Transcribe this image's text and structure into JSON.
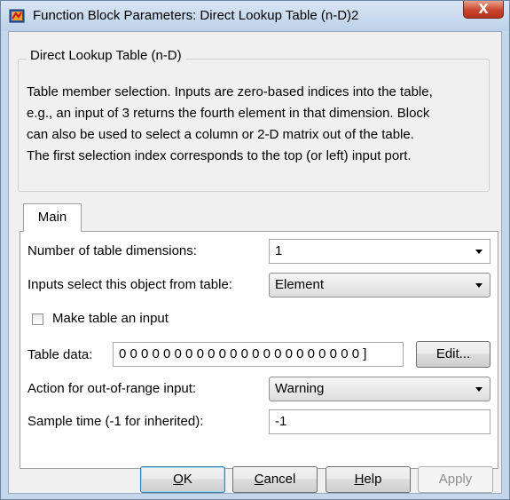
{
  "window": {
    "title": "Function Block Parameters: Direct Lookup Table (n-D)2",
    "close_label": "X"
  },
  "description": {
    "block_name": "Direct Lookup Table (n-D)",
    "lines": [
      "Table member selection.  Inputs are zero-based indices into the table,",
      "e.g., an input of 3 returns the fourth element in that dimension. Block",
      "can also be used to select a column or 2-D matrix out of the table.",
      "The first selection index corresponds to the top (or left) input port."
    ]
  },
  "tabs": [
    {
      "label": "Main",
      "selected": true
    }
  ],
  "params": {
    "num_dims": {
      "label": "Number of table dimensions:",
      "value": "1"
    },
    "select_object": {
      "label": "Inputs select this object from table:",
      "value": "Element"
    },
    "table_input": {
      "label": "Make table an input",
      "checked": false
    },
    "table_data": {
      "label": "Table data:",
      "value": "0 0 0 0 0 0 0 0 0 0 0 0 0 0 0 0 0 0 0 0 0 0 ]",
      "edit_label": "Edit..."
    },
    "out_of_range": {
      "label": "Action for out-of-range input:",
      "value": "Warning"
    },
    "sample_time": {
      "label": "Sample time (-1 for inherited):",
      "value": "-1"
    }
  },
  "buttons": {
    "ok": {
      "mnemonic": "O",
      "rest": "K"
    },
    "cancel": {
      "mnemonic": "C",
      "rest": "ancel"
    },
    "help": {
      "mnemonic": "H",
      "rest": "elp"
    },
    "apply": {
      "label": "Apply",
      "enabled": false
    }
  },
  "colors": {
    "frame": "#c4d6ea",
    "close_button": "#c9452d",
    "default_button_border": "#3c7fb1"
  }
}
